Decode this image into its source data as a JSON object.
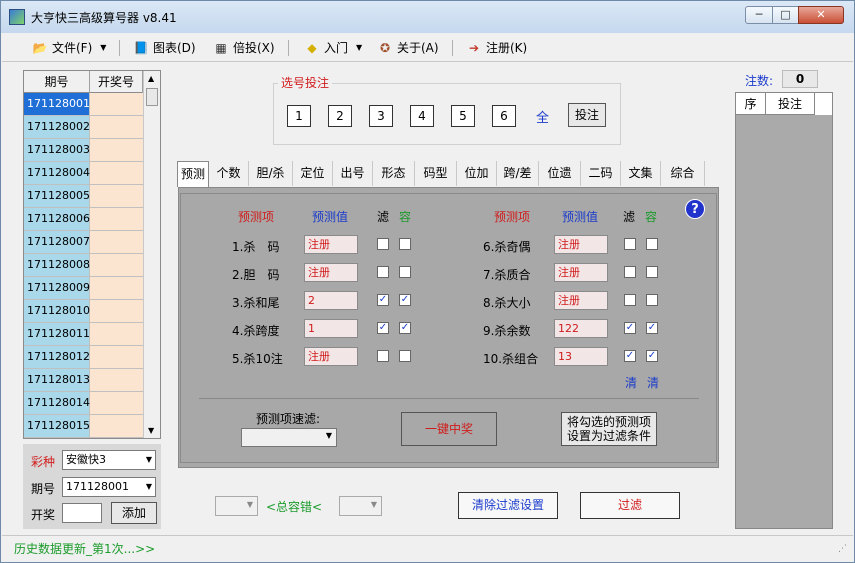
{
  "window": {
    "title": "大亨快三高级算号器 v8.41",
    "min_glyph": "─",
    "max_glyph": "□",
    "close_glyph": "✕"
  },
  "menu": {
    "file": {
      "label": "文件(F)",
      "icon": "folder-icon",
      "glyph": "📂"
    },
    "chart": {
      "label": "图表(D)",
      "icon": "chart-icon",
      "glyph": "📘"
    },
    "multiple": {
      "label": "倍投(X)",
      "icon": "grid-icon",
      "glyph": "▦"
    },
    "intro": {
      "label": "入门",
      "icon": "intro-icon",
      "glyph": "◆"
    },
    "about": {
      "label": "关于(A)",
      "icon": "about-icon",
      "glyph": "✪"
    },
    "register": {
      "label": "注册(K)",
      "icon": "register-icon",
      "glyph": "➔"
    }
  },
  "history": {
    "col_period": "期号",
    "col_prize": "开奖号",
    "rows": [
      "171128001",
      "171128002",
      "171128003",
      "171128004",
      "171128005",
      "171128006",
      "171128007",
      "171128008",
      "171128009",
      "171128010",
      "171128011",
      "171128012",
      "171128013",
      "171128014",
      "171128015"
    ],
    "scroll_up": "▲",
    "scroll_down": "▼"
  },
  "lottery": {
    "type_label": "彩种",
    "type_value": "安徽快3",
    "period_label": "期号",
    "period_value": "171128001",
    "open_label": "开奖",
    "add_label": "添加",
    "caret": "▼"
  },
  "select": {
    "title": "选号投注",
    "numbers": [
      "1",
      "2",
      "3",
      "4",
      "5",
      "6"
    ],
    "all_label": "全",
    "bet_label": "投注"
  },
  "right_panel": {
    "count_label": "注数:",
    "count_value": "0",
    "col_seq": "序",
    "col_bet": "投注"
  },
  "tabs": [
    "预测",
    "个数",
    "胆/杀",
    "定位",
    "出号",
    "形态",
    "码型",
    "位加",
    "跨/差",
    "位遗",
    "二码",
    "文集",
    "综合"
  ],
  "predict": {
    "h_item": "预测项",
    "h_value": "预测值",
    "h_filter": "滤",
    "h_tolerance": "容",
    "left_rows": [
      {
        "label": "1.杀　码",
        "value": "注册",
        "filter": false,
        "tolerance": false
      },
      {
        "label": "2.胆　码",
        "value": "注册",
        "filter": false,
        "tolerance": false
      },
      {
        "label": "3.杀和尾",
        "value": "2",
        "filter": true,
        "tolerance": true
      },
      {
        "label": "4.杀跨度",
        "value": "1",
        "filter": true,
        "tolerance": true
      },
      {
        "label": "5.杀10注",
        "value": "注册",
        "filter": false,
        "tolerance": false
      }
    ],
    "right_rows": [
      {
        "label": "6.杀奇偶",
        "value": "注册",
        "filter": false,
        "tolerance": false
      },
      {
        "label": "7.杀质合",
        "value": "注册",
        "filter": false,
        "tolerance": false
      },
      {
        "label": "8.杀大小",
        "value": "注册",
        "filter": false,
        "tolerance": false
      },
      {
        "label": "9.杀余数",
        "value": "122",
        "filter": true,
        "tolerance": true
      },
      {
        "label": "10.杀组合",
        "value": "13",
        "filter": true,
        "tolerance": true
      }
    ],
    "clear_filter": "清",
    "clear_tolerance": "清",
    "help_glyph": "?",
    "check_glyph": "✓",
    "quick_filter_label": "预测项速滤:",
    "win_button": "一键中奖",
    "set_filter_line1": "将勾选的预测项",
    "set_filter_line2": "设置为过滤条件"
  },
  "bottom": {
    "error_label": "<总容错<",
    "clear_button": "清除过滤设置",
    "filter_button": "过滤"
  },
  "status": {
    "text": "历史数据更新_第1次...>>",
    "grip": "⋰"
  },
  "colors": {
    "accent_red": "#d11c1c",
    "accent_blue": "#1a3bcc",
    "accent_green": "#1a9b2a"
  }
}
